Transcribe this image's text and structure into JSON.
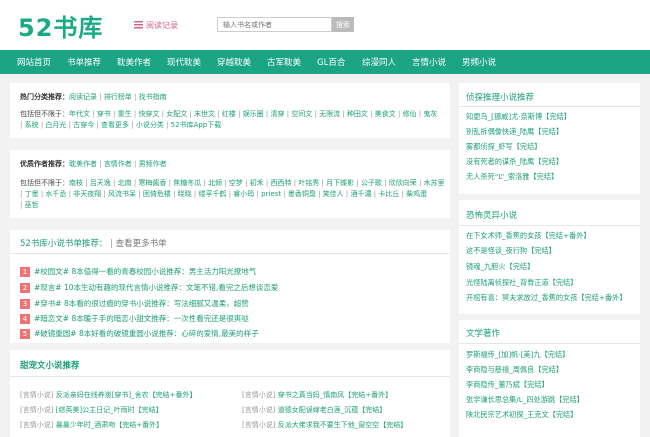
{
  "header": {
    "logo": "52书库",
    "history": "阅读记录",
    "search_placeholder": "输入书名或作者",
    "search_button": "搜索"
  },
  "nav": [
    "网站首页",
    "书单推荐",
    "耽美作者",
    "现代耽美",
    "穿越耽美",
    "古军耽美",
    "GL百合",
    "综漫同人",
    "言情小说",
    "男频小说"
  ],
  "hot_recommend": {
    "label": "热门分类推荐：",
    "links": [
      "阅读记录",
      "排行榜单",
      "找书指南"
    ],
    "include_label": "包括但不限于：",
    "line1": [
      "年代文",
      "穿书",
      "重生",
      "快穿文",
      "女配文",
      "末世文",
      "红楼",
      "娱乐圈",
      "清穿",
      "空间文",
      "无限流",
      "种田文",
      "美食文",
      "修仙",
      "鬼灰"
    ],
    "line2": [
      "系统",
      "白月光",
      "古穿今",
      "查看更多",
      "小说分类",
      "52书库App下载"
    ]
  },
  "author_recommend": {
    "label": "优质作者推荐：",
    "links": [
      "耽美作者",
      "言情作者",
      "男频作者"
    ],
    "include_label": "包括但不限于：",
    "line1": [
      "南枝",
      "吕天逸",
      "北南",
      "寒梅酱香",
      "焦糖冬瓜",
      "北倾",
      "空梦",
      "初禾",
      "西西特",
      "叶铭秀",
      "月下蝶影",
      "公子歌",
      "欣欣向荣",
      "木苏里"
    ],
    "line2": [
      "丁墨",
      "水千丞",
      "非天夜翔",
      "风流书呆",
      "困倚危楼",
      "晓晓",
      "缕孚千鹤",
      "睿小筠",
      "priest",
      "墨香铜臭",
      "笑佳人",
      "酒千濃",
      "卡比丘",
      "柴鸡蛋"
    ],
    "line3": [
      "巫哲"
    ]
  },
  "booklist": {
    "title": "52书库小说书单推荐：",
    "more": "查看更多书单",
    "items": [
      {
        "num": "1",
        "text": "#校园文# 8本值得一看的青春校园小说推荐：男主活力阳光撩地气"
      },
      {
        "num": "2",
        "text": "#现言# 10本生动有趣的现代言情小说推荐：文笔不错,看完之后想谈恋爱"
      },
      {
        "num": "3",
        "text": "#穿书# 8本看的很过瘾的穿书小说推荐：写法细腻又温柔，超赞"
      },
      {
        "num": "4",
        "text": "#暗恋文# 8本暖于手的暗恋小甜文推荐：一次性看完还是很爽哒"
      },
      {
        "num": "5",
        "text": "#破镜重圆# 8本好看的破镜重圆小说推荐：心碎的爱情,最美的样子"
      }
    ]
  },
  "sweet": {
    "title": "甜宠文小说推荐",
    "items": [
      {
        "tag": "[言情小说]",
        "text": "反派亲妈在线养崽[穿书]_舍农【完结+番外】"
      },
      {
        "tag": "[言情小说]",
        "text": "穿书之真当妈_慎南风【完结+番外】"
      },
      {
        "tag": "[言情小说]",
        "text": "[综英美]公主日记_叶雨时【完结】"
      },
      {
        "tag": "[言情小说]",
        "text": "道德女配误嫁老白莲_沉蕴【完结】"
      },
      {
        "tag": "[言情小说]",
        "text": "暴暴少年时_酒肃吻【完结+番外】"
      },
      {
        "tag": "[言情小说]",
        "text": "反派大佬求我不要生下他_窗空空【完结】"
      }
    ]
  },
  "side1": {
    "title": "侦探推理小说推荐",
    "items": [
      "知更鸟_[挪威]尤·奈斯博【完结】",
      "别乱拆偶像快递_陆鹰【完结】",
      "雾都侦探_虾写【完结】",
      "没有死者的谋杀_陆鹰【完结】",
      "无人杀死“L”_索洛雅【完结】"
    ]
  },
  "side2": {
    "title": "恐怖灵异小说",
    "items": [
      "在下女术师_香蕉的女孩【完结+番外】",
      "这不是怪谈_夜行狗【完结】",
      "镜魂_九胆火【完结】",
      "光怪陆离侦探社_背脊正道【完结】",
      "开棺有喜：冥夫求放过_香蕉的女孩【完结+番外】"
    ]
  },
  "side3": {
    "title": "文学著作",
    "items": [
      "罗斯福传_[加]帆·[美]九【完结】",
      "李商隐与慈禧_周佩良【完结】",
      "李商隐传_董乃斌【完结】",
      "张学谦长思总集/L_四处游跳【完结】",
      "陕北民宗艺术初探_王克文【完结】"
    ]
  }
}
